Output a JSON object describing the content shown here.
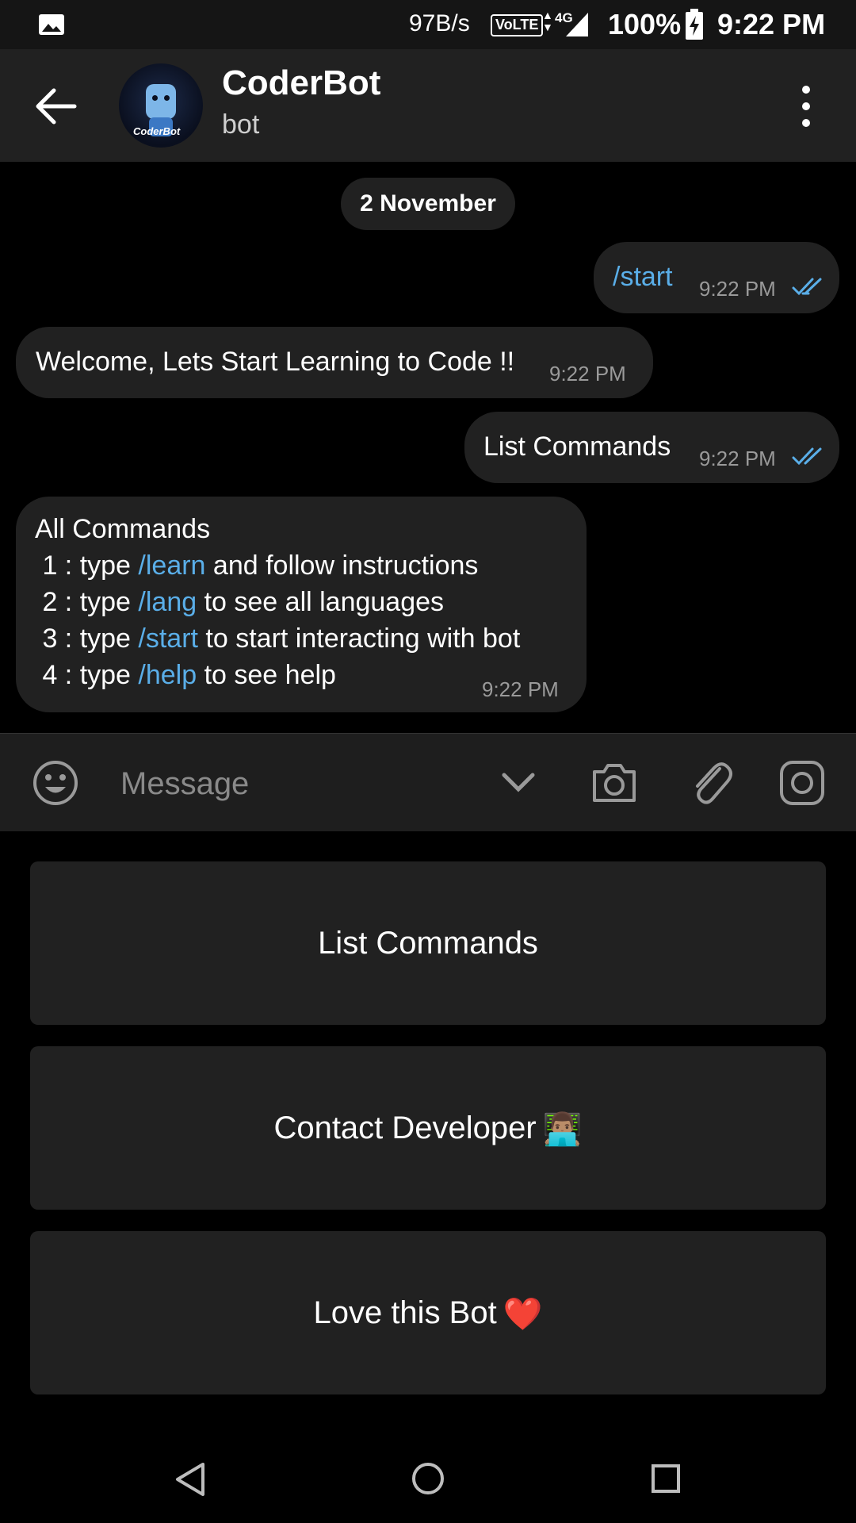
{
  "status_bar": {
    "network_speed": "97B/s",
    "volte": "VoLTE",
    "network_type": "4G",
    "battery_percent": "100%",
    "time": "9:22 PM"
  },
  "header": {
    "title": "CoderBot",
    "subtitle": "bot",
    "avatar_text": "CoderBot"
  },
  "chat": {
    "date_label": "2 November",
    "messages": [
      {
        "direction": "outgoing",
        "text": "/start",
        "time": "9:22 PM",
        "status": "read"
      },
      {
        "direction": "incoming",
        "text": "Welcome, Lets Start Learning to Code !!",
        "time": "9:22 PM"
      },
      {
        "direction": "outgoing",
        "text": "List Commands",
        "time": "9:22 PM",
        "status": "read"
      },
      {
        "direction": "incoming",
        "time": "9:22 PM",
        "lines": [
          {
            "pre": "All Commands",
            "cmd": "",
            "post": ""
          },
          {
            "pre": " 1 : type ",
            "cmd": "/learn",
            "post": " and follow instructions"
          },
          {
            "pre": " 2 : type ",
            "cmd": "/lang",
            "post": " to see all languages"
          },
          {
            "pre": " 3 : type ",
            "cmd": "/start",
            "post": " to start interacting with bot"
          },
          {
            "pre": " 4 : type ",
            "cmd": "/help",
            "post": " to see help"
          }
        ]
      }
    ]
  },
  "input": {
    "placeholder": "Message",
    "value": ""
  },
  "keyboard": {
    "buttons": [
      {
        "label": "List Commands",
        "emoji": ""
      },
      {
        "label": "Contact Developer",
        "emoji": "👨🏽‍💻"
      },
      {
        "label": "Love this Bot",
        "emoji": "❤️"
      }
    ]
  },
  "icons": {
    "back": "arrow-left-icon",
    "menu": "more-vertical-icon",
    "emoji": "emoji-icon",
    "commands_toggle": "chevron-down-icon",
    "camera": "camera-icon",
    "attach": "paperclip-icon",
    "instagram": "instagram-icon"
  },
  "colors": {
    "background": "#000000",
    "surface": "#212121",
    "accent_link": "#5aaee8",
    "timestamp": "#9a9a9a"
  }
}
